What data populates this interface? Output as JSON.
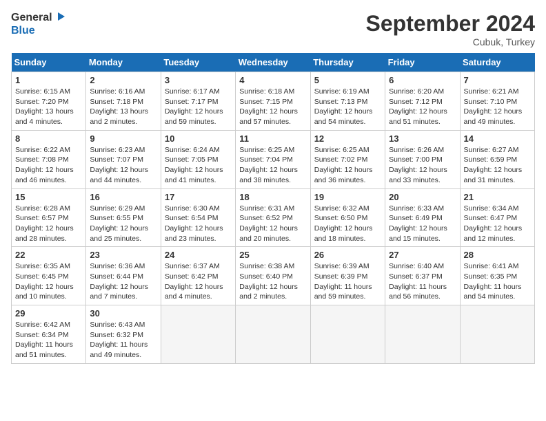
{
  "header": {
    "logo_line1": "General",
    "logo_line2": "Blue",
    "month": "September 2024",
    "location": "Cubuk, Turkey"
  },
  "days_of_week": [
    "Sunday",
    "Monday",
    "Tuesday",
    "Wednesday",
    "Thursday",
    "Friday",
    "Saturday"
  ],
  "weeks": [
    [
      {
        "num": "1",
        "sunrise": "6:15 AM",
        "sunset": "7:20 PM",
        "daylight": "13 hours and 4 minutes."
      },
      {
        "num": "2",
        "sunrise": "6:16 AM",
        "sunset": "7:18 PM",
        "daylight": "13 hours and 2 minutes."
      },
      {
        "num": "3",
        "sunrise": "6:17 AM",
        "sunset": "7:17 PM",
        "daylight": "12 hours and 59 minutes."
      },
      {
        "num": "4",
        "sunrise": "6:18 AM",
        "sunset": "7:15 PM",
        "daylight": "12 hours and 57 minutes."
      },
      {
        "num": "5",
        "sunrise": "6:19 AM",
        "sunset": "7:13 PM",
        "daylight": "12 hours and 54 minutes."
      },
      {
        "num": "6",
        "sunrise": "6:20 AM",
        "sunset": "7:12 PM",
        "daylight": "12 hours and 51 minutes."
      },
      {
        "num": "7",
        "sunrise": "6:21 AM",
        "sunset": "7:10 PM",
        "daylight": "12 hours and 49 minutes."
      }
    ],
    [
      {
        "num": "8",
        "sunrise": "6:22 AM",
        "sunset": "7:08 PM",
        "daylight": "12 hours and 46 minutes."
      },
      {
        "num": "9",
        "sunrise": "6:23 AM",
        "sunset": "7:07 PM",
        "daylight": "12 hours and 44 minutes."
      },
      {
        "num": "10",
        "sunrise": "6:24 AM",
        "sunset": "7:05 PM",
        "daylight": "12 hours and 41 minutes."
      },
      {
        "num": "11",
        "sunrise": "6:25 AM",
        "sunset": "7:04 PM",
        "daylight": "12 hours and 38 minutes."
      },
      {
        "num": "12",
        "sunrise": "6:25 AM",
        "sunset": "7:02 PM",
        "daylight": "12 hours and 36 minutes."
      },
      {
        "num": "13",
        "sunrise": "6:26 AM",
        "sunset": "7:00 PM",
        "daylight": "12 hours and 33 minutes."
      },
      {
        "num": "14",
        "sunrise": "6:27 AM",
        "sunset": "6:59 PM",
        "daylight": "12 hours and 31 minutes."
      }
    ],
    [
      {
        "num": "15",
        "sunrise": "6:28 AM",
        "sunset": "6:57 PM",
        "daylight": "12 hours and 28 minutes."
      },
      {
        "num": "16",
        "sunrise": "6:29 AM",
        "sunset": "6:55 PM",
        "daylight": "12 hours and 25 minutes."
      },
      {
        "num": "17",
        "sunrise": "6:30 AM",
        "sunset": "6:54 PM",
        "daylight": "12 hours and 23 minutes."
      },
      {
        "num": "18",
        "sunrise": "6:31 AM",
        "sunset": "6:52 PM",
        "daylight": "12 hours and 20 minutes."
      },
      {
        "num": "19",
        "sunrise": "6:32 AM",
        "sunset": "6:50 PM",
        "daylight": "12 hours and 18 minutes."
      },
      {
        "num": "20",
        "sunrise": "6:33 AM",
        "sunset": "6:49 PM",
        "daylight": "12 hours and 15 minutes."
      },
      {
        "num": "21",
        "sunrise": "6:34 AM",
        "sunset": "6:47 PM",
        "daylight": "12 hours and 12 minutes."
      }
    ],
    [
      {
        "num": "22",
        "sunrise": "6:35 AM",
        "sunset": "6:45 PM",
        "daylight": "12 hours and 10 minutes."
      },
      {
        "num": "23",
        "sunrise": "6:36 AM",
        "sunset": "6:44 PM",
        "daylight": "12 hours and 7 minutes."
      },
      {
        "num": "24",
        "sunrise": "6:37 AM",
        "sunset": "6:42 PM",
        "daylight": "12 hours and 4 minutes."
      },
      {
        "num": "25",
        "sunrise": "6:38 AM",
        "sunset": "6:40 PM",
        "daylight": "12 hours and 2 minutes."
      },
      {
        "num": "26",
        "sunrise": "6:39 AM",
        "sunset": "6:39 PM",
        "daylight": "11 hours and 59 minutes."
      },
      {
        "num": "27",
        "sunrise": "6:40 AM",
        "sunset": "6:37 PM",
        "daylight": "11 hours and 56 minutes."
      },
      {
        "num": "28",
        "sunrise": "6:41 AM",
        "sunset": "6:35 PM",
        "daylight": "11 hours and 54 minutes."
      }
    ],
    [
      {
        "num": "29",
        "sunrise": "6:42 AM",
        "sunset": "6:34 PM",
        "daylight": "11 hours and 51 minutes."
      },
      {
        "num": "30",
        "sunrise": "6:43 AM",
        "sunset": "6:32 PM",
        "daylight": "11 hours and 49 minutes."
      },
      null,
      null,
      null,
      null,
      null
    ]
  ]
}
